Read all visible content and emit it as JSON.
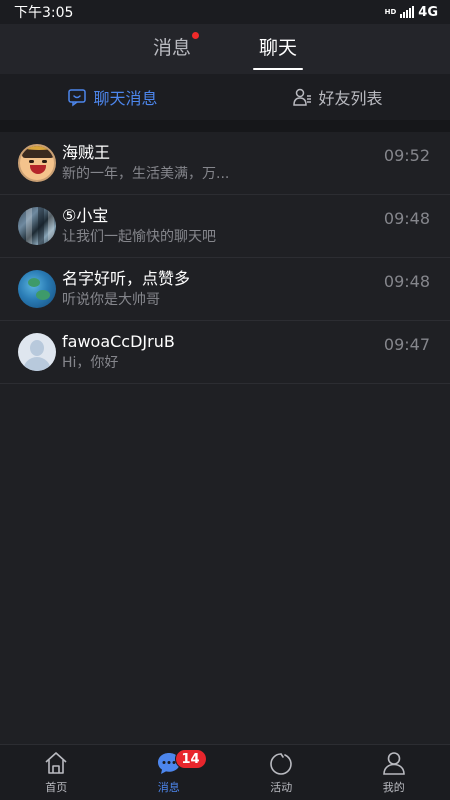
{
  "status_bar": {
    "time": "下午3:05",
    "network": "4G",
    "hd_label": "HD"
  },
  "top_tabs": [
    {
      "label": "消息",
      "active": false,
      "has_dot": true
    },
    {
      "label": "聊天",
      "active": true,
      "has_dot": false
    }
  ],
  "sub_tabs": [
    {
      "label": "聊天消息",
      "icon": "chat-bubble-icon",
      "active": true
    },
    {
      "label": "好友列表",
      "icon": "friends-icon",
      "active": false
    }
  ],
  "chats": [
    {
      "name": "海贼王",
      "message": "新的一年，生活美满，万...",
      "time": "09:52",
      "avatar": "luffy"
    },
    {
      "name": "⑤小宝",
      "message": "让我们一起愉快的聊天吧",
      "time": "09:48",
      "avatar": "photo"
    },
    {
      "name": "名字好听，点赞多",
      "message": "听说你是大帅哥",
      "time": "09:48",
      "avatar": "earth"
    },
    {
      "name": "fawoaCcDJruB",
      "message": "Hi，你好",
      "time": "09:47",
      "avatar": "default"
    }
  ],
  "bottom_nav": [
    {
      "label": "首页",
      "icon": "home-icon",
      "active": false
    },
    {
      "label": "消息",
      "icon": "message-icon",
      "active": true,
      "badge": "14"
    },
    {
      "label": "活动",
      "icon": "activity-icon",
      "active": false
    },
    {
      "label": "我的",
      "icon": "profile-icon",
      "active": false
    }
  ],
  "colors": {
    "accent": "#4d86ec",
    "badge": "#e8262d",
    "background": "#1f2024"
  }
}
